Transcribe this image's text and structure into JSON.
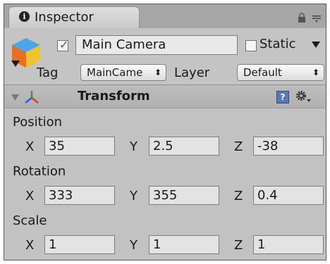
{
  "tab": {
    "title": "Inspector",
    "icon": "info-icon"
  },
  "header": {
    "active_checked": true,
    "object_name": "Main Camera",
    "static_label": "Static",
    "static_checked": false,
    "tag_label": "Tag",
    "tag_value": "MainCame",
    "layer_label": "Layer",
    "layer_value": "Default"
  },
  "component": {
    "title": "Transform",
    "help_glyph": "?"
  },
  "transform": {
    "position": {
      "label": "Position",
      "x_label": "X",
      "x": "35",
      "y_label": "Y",
      "y": "2.5",
      "z_label": "Z",
      "z": "-38"
    },
    "rotation": {
      "label": "Rotation",
      "x_label": "X",
      "x": "333",
      "y_label": "Y",
      "y": "355",
      "z_label": "Z",
      "z": "0.4"
    },
    "scale": {
      "label": "Scale",
      "x_label": "X",
      "x": "1",
      "y_label": "Y",
      "y": "1",
      "z_label": "Z",
      "z": "1"
    }
  },
  "colors": {
    "panel_bg": "#c2c2c2",
    "checkbox_tick": "#2a56c8",
    "help_icon": "#5878b8"
  }
}
